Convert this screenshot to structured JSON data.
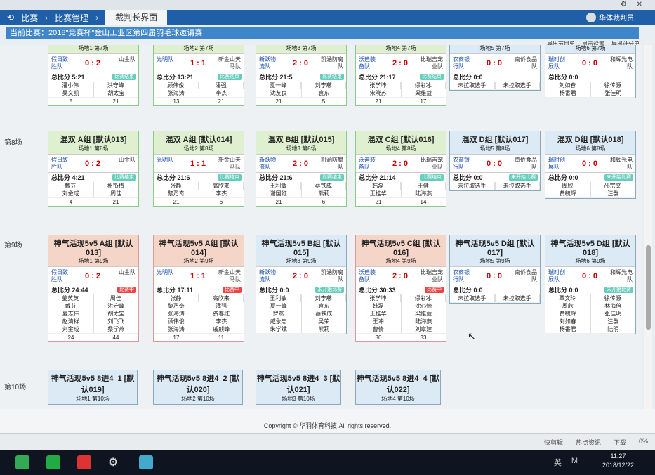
{
  "window": {
    "gear": "⚙",
    "close": "✕",
    "user": "华体裁判员"
  },
  "breadcrumb": {
    "back": "比赛",
    "mid": "比赛管理",
    "current": "裁判长界面"
  },
  "banner": "当前比赛：2018\"竞赛杯\"金山工业区第四届羽毛球邀请赛",
  "tools": [
    "导出节目单",
    "显示设置",
    "导出计分单"
  ],
  "rows": [
    "第8场",
    "第9场",
    "第10场"
  ],
  "cards_r0": [
    {
      "title": "",
      "sub": "场地1 第7场",
      "t1": "假日致胜队",
      "score": "0 : 2",
      "t2": "山金队",
      "total": "总比分 5:21",
      "tag": "比赛结束",
      "p1": [
        "潘小伟",
        "吴文凯"
      ],
      "p2": [
        "洪守峰",
        "胡太宝"
      ],
      "s1": "5",
      "s2": "21",
      "color": "green"
    },
    {
      "title": "",
      "sub": "场地2 第7场",
      "t1": "光明队",
      "score": "1 : 1",
      "t2": "新金山天马队",
      "total": "总比分 13:21",
      "tag": "比赛结束",
      "p1": [
        "顾伟俊",
        "张海涛"
      ],
      "p2": [
        "潘强",
        "李杰"
      ],
      "s1": "13",
      "s2": "21",
      "color": "green"
    },
    {
      "title": "",
      "sub": "场地3 第7场",
      "t1": "新跃物流队",
      "score": "2 : 0",
      "t2": "凯涵防腐队",
      "total": "总比分 21:5",
      "tag": "比赛结束",
      "p1": [
        "夏一峰",
        "沈友良"
      ],
      "p2": [
        "刘李慈",
        "袁东"
      ],
      "s1": "21",
      "s2": "5",
      "color": "green"
    },
    {
      "title": "",
      "sub": "场地4 第7场",
      "t1": "沃迪装备队",
      "score": "2 : 0",
      "t2": "比瑞吉宠业队",
      "total": "总比分 21:17",
      "tag": "比赛结束",
      "p1": [
        "张学坤",
        "宋晓苏"
      ],
      "p2": [
        "缪彩冰",
        "梁维益"
      ],
      "s1": "21",
      "s2": "17",
      "color": "green"
    },
    {
      "title": "",
      "sub": "场地5 第7场",
      "t1": "农商银行队",
      "score": "0 : 0",
      "t2": "南侨食品队",
      "total": "总比分 0:0",
      "tag": "",
      "p1": [
        "未拉取选手"
      ],
      "p2": [
        "未拉取选手"
      ],
      "s1": "",
      "s2": "",
      "color": "blue"
    },
    {
      "title": "",
      "sub": "场地6 第7场",
      "t1": "瑞时创展队",
      "score": "0 : 0",
      "t2": "和辉光电队",
      "total": "总比分 0:0",
      "tag": "",
      "p1": [
        "刘如春",
        "杨番君"
      ],
      "p2": [
        "徐传源",
        "张佳明"
      ],
      "s1": "",
      "s2": "",
      "color": "blue"
    }
  ],
  "cards_r1": [
    {
      "title": "混双 A组 [默认013]",
      "sub": "场地1 第8场",
      "t1": "假日致胜队",
      "score": "0 : 2",
      "t2": "山金队",
      "total": "总比分 4:21",
      "tag": "比赛结束",
      "p1": [
        "戴芬",
        "刘金成"
      ],
      "p2": [
        "朴衔植",
        "周佳"
      ],
      "s1": "4",
      "s2": "21",
      "color": "green"
    },
    {
      "title": "混双 A组 [默认014]",
      "sub": "场地2 第8场",
      "t1": "光明队",
      "score": "1 : 1",
      "t2": "新金山天马队",
      "total": "总比分 21:6",
      "tag": "比赛结束",
      "p1": [
        "张静",
        "黎乃奇"
      ],
      "p2": [
        "高欣来",
        "李杰"
      ],
      "s1": "21",
      "s2": "6",
      "color": "green"
    },
    {
      "title": "混双 B组 [默认015]",
      "sub": "场地3 第8场",
      "t1": "新跃物流队",
      "score": "2 : 0",
      "t2": "凯涵防腐队",
      "total": "总比分 21:6",
      "tag": "比赛结束",
      "p1": [
        "王利敏",
        "谢国红"
      ],
      "p2": [
        "蔡铁成",
        "熊莉"
      ],
      "s1": "21",
      "s2": "6",
      "color": "green"
    },
    {
      "title": "混双 C组 [默认016]",
      "sub": "场地4 第8场",
      "t1": "沃迪装备队",
      "score": "2 : 0",
      "t2": "比瑞吉宠业队",
      "total": "总比分 21:14",
      "tag": "比赛结束",
      "p1": [
        "韩磊",
        "王桂华"
      ],
      "p2": [
        "王健",
        "陆海燕"
      ],
      "s1": "21",
      "s2": "14",
      "color": "green"
    },
    {
      "title": "混双 D组 [默认017]",
      "sub": "场地5 第8场",
      "t1": "农商银行队",
      "score": "0 : 0",
      "t2": "南侨食品队",
      "total": "总比分 0:0",
      "tag": "未开始比赛",
      "p1": [
        "未拉取选手"
      ],
      "p2": [
        "未拉取选手"
      ],
      "s1": "",
      "s2": "",
      "color": "blue"
    },
    {
      "title": "混双 D组 [默认018]",
      "sub": "场地6 第8场",
      "t1": "瑞时创展队",
      "score": "0 : 0",
      "t2": "和辉光电队",
      "total": "总比分 0:0",
      "tag": "未开始比赛",
      "p1": [
        "周欣",
        "黄毓辉"
      ],
      "p2": [
        "邵宗文",
        "汪群"
      ],
      "s1": "",
      "s2": "",
      "color": "blue"
    }
  ],
  "cards_r2": [
    {
      "title": "神气活现5v5 A组 [默认013]",
      "sub": "场地1 第9场",
      "t1": "假日致胜队",
      "score": "0 : 2",
      "t2": "山金队",
      "total": "总比分 24:44",
      "tag": "比赛中",
      "p1": [
        "姜英英",
        "戴芬",
        "夏志伟",
        "赵清祥",
        "刘金成"
      ],
      "p2": [
        "周佳",
        "洪守峰",
        "胡太宝",
        "刘飞飞",
        "桑学燕"
      ],
      "s1": "24",
      "s2": "44",
      "color": "red"
    },
    {
      "title": "神气活现5v5 A组 [默认014]",
      "sub": "场地2 第9场",
      "t1": "光明队",
      "score": "1 : 1",
      "t2": "新金山天马队",
      "total": "总比分 17:11",
      "tag": "比赛中",
      "p1": [
        "张静",
        "黎乃奇",
        "张海涛",
        "顾伟俊",
        "张海涛"
      ],
      "p2": [
        "高欣来",
        "潘强",
        "费春红",
        "李杰",
        "戚麒峰"
      ],
      "s1": "17",
      "s2": "11",
      "color": "red"
    },
    {
      "title": "神气活现5v5 B组 [默认015]",
      "sub": "场地3 第9场",
      "t1": "新跃物流队",
      "score": "2 : 0",
      "t2": "凯涵防腐队",
      "total": "总比分 0:0",
      "tag": "未开始比赛",
      "p1": [
        "王利敏",
        "夏一峰",
        "罗燕",
        "戚永忠",
        "朱学斌"
      ],
      "p2": [
        "刘李慈",
        "袁东",
        "蔡铁成",
        "吴荣",
        "熊莉"
      ],
      "s1": "",
      "s2": "",
      "color": "blue"
    },
    {
      "title": "神气活现5v5 C组 [默认016]",
      "sub": "场地4 第9场",
      "t1": "沃迪装备队",
      "score": "2 : 0",
      "t2": "比瑞吉宠业队",
      "total": "总比分 30:33",
      "tag": "比赛中",
      "p1": [
        "张学坤",
        "韩磊",
        "王桂华",
        "王冲",
        "曹倩"
      ],
      "p2": [
        "缪彩冰",
        "沈心怡",
        "梁维益",
        "陆海燕",
        "刘章建"
      ],
      "s1": "30",
      "s2": "33",
      "color": "red"
    },
    {
      "title": "神气活现5v5 D组 [默认017]",
      "sub": "场地5 第9场",
      "t1": "农商银行队",
      "score": "0 : 0",
      "t2": "南侨食品队",
      "total": "总比分 0:0",
      "tag": "",
      "p1": [
        "未拉取选手"
      ],
      "p2": [
        "未拉取选手"
      ],
      "s1": "",
      "s2": "",
      "color": "blue"
    },
    {
      "title": "神气活现5v5 D组 [默认018]",
      "sub": "场地6 第9场",
      "t1": "瑞时创展队",
      "score": "0 : 0",
      "t2": "和辉光电队",
      "total": "总比分 0:0",
      "tag": "未开始比赛",
      "p1": [
        "覃文玲",
        "周欣",
        "黄毓辉",
        "刘如春",
        "杨番君"
      ],
      "p2": [
        "徐传源",
        "林海倍",
        "张佳明",
        "汪群",
        "陆明"
      ],
      "s1": "",
      "s2": "",
      "color": "blue"
    }
  ],
  "cards_r3": [
    {
      "title": "神气活现5v5 8进4_1 [默认019]",
      "sub": "场地1 第10场"
    },
    {
      "title": "神气活现5v5 8进4_2 [默认020]",
      "sub": "场地2 第10场"
    },
    {
      "title": "神气活现5v5 8进4_3 [默认021]",
      "sub": "场地3 第10场"
    },
    {
      "title": "神气活现5v5 8进4_4 [默认022]",
      "sub": "场地4 第10场"
    }
  ],
  "footer": "Copyright © 华羽体育科技 All rights reserved.",
  "status": [
    "快剪辑",
    "热点资讯",
    "下载",
    "0%"
  ],
  "clock": {
    "time": "11:27",
    "date": "2018/12/22"
  },
  "tray": [
    "英",
    "M"
  ]
}
